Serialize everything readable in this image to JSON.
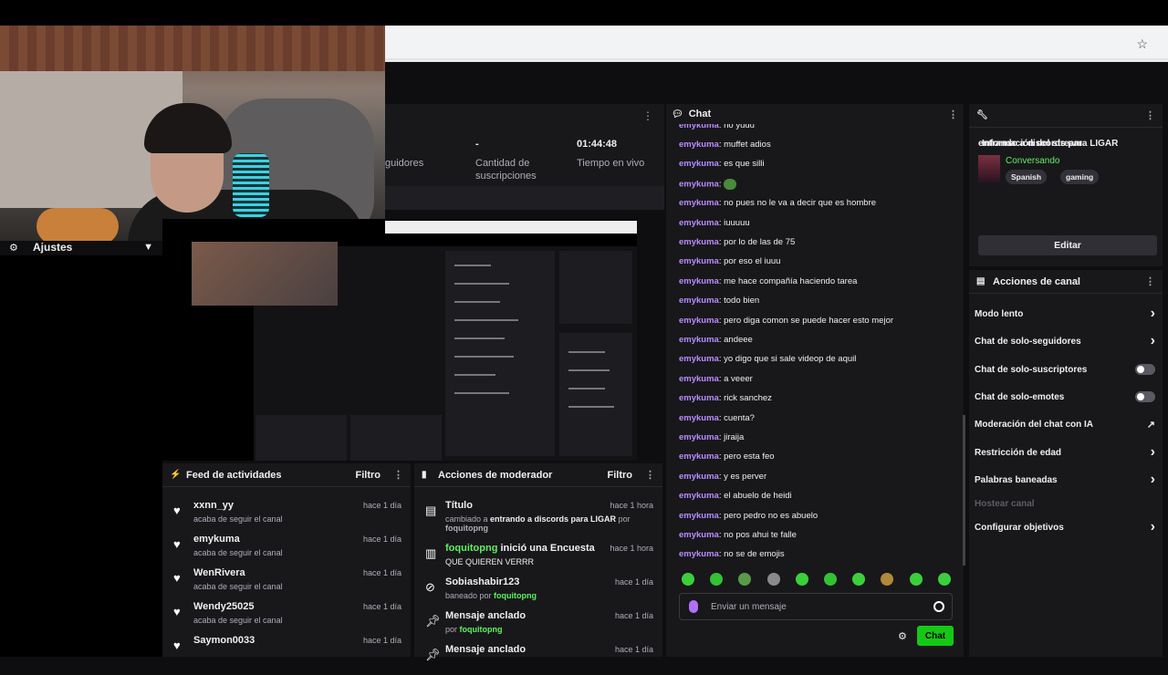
{
  "settings": {
    "label": "Ajustes"
  },
  "stats": {
    "followers_label": "guidores",
    "subs_value": "-",
    "subs_label_1": "Cantidad de",
    "subs_label_2": "suscripciones",
    "time_value": "01:44:48",
    "time_label": "Tiempo en vivo"
  },
  "feed": {
    "title": "Feed de actividades",
    "filter": "Filtro",
    "items": [
      {
        "name": "xxnn_yy",
        "sub": "acaba de seguir el canal",
        "time": "hace 1 día"
      },
      {
        "name": "emykuma",
        "sub": "acaba de seguir el canal",
        "time": "hace 1 día"
      },
      {
        "name": "WenRivera",
        "sub": "acaba de seguir el canal",
        "time": "hace 1 día"
      },
      {
        "name": "Wendy25025",
        "sub": "acaba de seguir el canal",
        "time": "hace 1 día"
      },
      {
        "name": "Saymon0033",
        "sub": "",
        "time": "hace 1 día"
      }
    ]
  },
  "modactions": {
    "title": "Acciones de moderador",
    "filter": "Filtro",
    "items": [
      {
        "title": "Título",
        "line1_pre": "cambiado a ",
        "line1_bold": "entrando a discords para LIGAR",
        "line1_post": " por",
        "line2": "foquitopng",
        "time": "hace 1 hora"
      },
      {
        "title_green": "foquitopng",
        "title_rest": " inició una Encuesta",
        "line1": "QUE QUIEREN VERRR",
        "time": "hace 1 hora"
      },
      {
        "title": "Sobiashabir123",
        "line1": "baneado por ",
        "line1_green": "foquitopng",
        "time": "hace 1 día"
      },
      {
        "title": "Mensaje anclado",
        "line1": "por ",
        "line1_green": "foquitopng",
        "time": "hace 1 día"
      },
      {
        "title": "Mensaje anclado",
        "time": "hace 1 día"
      }
    ]
  },
  "chat": {
    "title": "Chat",
    "top_partial": "no yudu",
    "user": "emykuma",
    "messages": [
      "muffet adios",
      "es que silli",
      "",
      "no pues no le va a decir que es hombre",
      "iuuuuu",
      "por lo de las de 75",
      "por eso el iuuu",
      "me hace compañía haciendo tarea",
      "todo bien",
      "pero diga comon se puede hacer esto mejor",
      "andeee",
      "yo digo que si sale videop de aquil",
      "a veeer",
      "rick sanchez",
      "cuenta?",
      "jiraija",
      "pero esta feo",
      "y es perver",
      "el abuelo de heidi",
      "pero pedro no es abuelo",
      "no pos ahui te falle",
      "no se de emojis"
    ],
    "placeholder": "Enviar un mensaje",
    "send": "Chat"
  },
  "stream_info": {
    "header": "Información del stream",
    "title": "entrando a discords para LIGAR",
    "category": "Conversando",
    "tags": [
      "Spanish",
      "gaming"
    ],
    "edit": "Editar"
  },
  "channel_actions": {
    "header": "Acciones de canal",
    "items": [
      {
        "label": "Modo lento",
        "control": "chevron"
      },
      {
        "label": "Chat de solo-seguidores",
        "control": "chevron"
      },
      {
        "label": "Chat de solo-suscriptores",
        "control": "toggle"
      },
      {
        "label": "Chat de solo-emotes",
        "control": "toggle"
      },
      {
        "label": "Moderación del chat con IA",
        "control": "external"
      },
      {
        "label": "Restricción de edad",
        "control": "chevron"
      },
      {
        "label": "Palabras baneadas",
        "control": "chevron"
      },
      {
        "label": "Hostear canal",
        "control": "disabled"
      },
      {
        "label": "Configurar objetivos",
        "control": "chevron"
      }
    ]
  },
  "colors": {
    "accent_green": "#5ff05f",
    "username_purple": "#b98cff",
    "send_button": "#16c816"
  }
}
